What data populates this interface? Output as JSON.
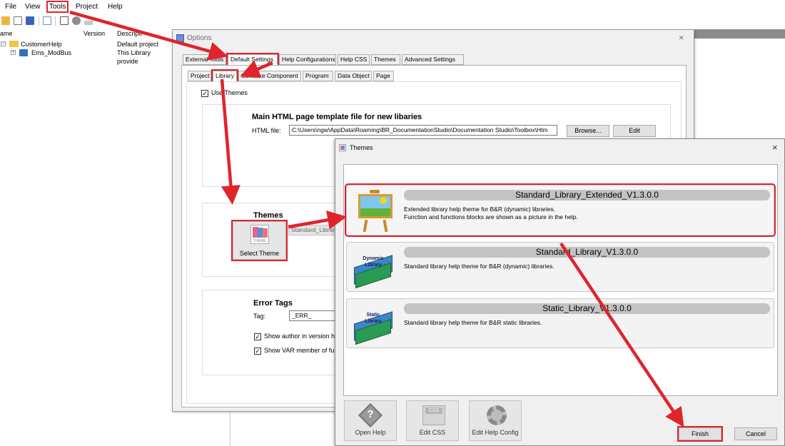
{
  "menu": {
    "file": "File",
    "view": "View",
    "tools": "Tools",
    "project": "Project",
    "help": "Help"
  },
  "tree": {
    "columns": {
      "name": "ame",
      "version": "Version",
      "description": "Descripti"
    },
    "rows": [
      {
        "name": "CustomerHelp",
        "description": "Default project"
      },
      {
        "name": "Ems_ModBus",
        "description": "This Library provide"
      }
    ]
  },
  "options_dialog": {
    "title": "Options",
    "tabs": [
      "External Tools",
      "Default Settings",
      "Help Configurations",
      "Help CSS",
      "Themes",
      "Advanced Settings"
    ],
    "subtabs": [
      "Project",
      "Library",
      "Software Component",
      "Program",
      "Data Object",
      "Page"
    ],
    "use_themes_label": "Use Themes",
    "main_template": {
      "heading": "Main HTML page template file for new libaries",
      "field_label": "HTML file:",
      "value": "C:\\Users\\ngw\\AppData\\Roaming\\BR_DocumentationStudio\\Documentation Studio\\Toolbox\\Htm",
      "browse_label": "Browse...",
      "edit_label": "Edit"
    },
    "themes_section": {
      "heading": "Themes",
      "select_theme_label": "Select Theme",
      "theme_icon_text": "THEME",
      "selected_theme_value": "Standard_Librar"
    },
    "error_tags": {
      "heading": "Error Tags",
      "tag_label": "Tag:",
      "tag_value": "_ERR_",
      "show_author_label": "Show author in version his",
      "show_var_label": "Show VAR member of func"
    }
  },
  "themes_dialog": {
    "title": "Themes",
    "items": [
      {
        "name": "Standard_Library_Extended_V1.3.0.0",
        "line1": "Extended library help theme for B&R (dynamic) libraries.",
        "line2": "Function and functions blocks are shown as a picture in the help.",
        "icon": "easel-icon",
        "icon_text": ""
      },
      {
        "name": "Standard_Library_V1.3.0.0",
        "line1": "Standard library help theme for B&R (dynamic) libraries.",
        "line2": "",
        "icon": "books-icon",
        "icon_text": "Dynamic Library"
      },
      {
        "name": "Static_Library_V1.3.0.0",
        "line1": "Standard library help theme for B&R static libraries.",
        "line2": "",
        "icon": "books-icon",
        "icon_text": "Static Library"
      }
    ],
    "buttons": {
      "open_help": "Open Help",
      "edit_css": "Edit CSS",
      "edit_css_icon_text": "CSS",
      "edit_help_config": "Edit Help Config",
      "finish": "Finish",
      "cancel": "Cancel"
    }
  },
  "colors": {
    "highlight_red": "#e0242c",
    "window_bg": "#f0f0f0"
  }
}
